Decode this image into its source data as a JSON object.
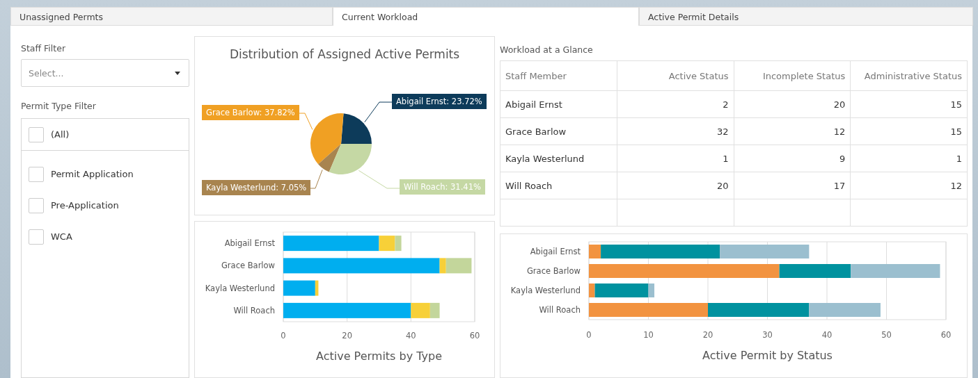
{
  "tabs": [
    {
      "label": "Unassigned Permts",
      "selected": false
    },
    {
      "label": "Current Workload",
      "selected": true
    },
    {
      "label": "Active Permit Details",
      "selected": false
    }
  ],
  "filters": {
    "staff_label": "Staff Filter",
    "staff_select": {
      "placeholder": "Select..."
    },
    "type_label": "Permit Type Filter",
    "type_options": [
      {
        "label": "(All)",
        "checked": false
      },
      {
        "label": "Permit Application",
        "checked": false
      },
      {
        "label": "Pre-Application",
        "checked": false
      },
      {
        "label": "WCA",
        "checked": false
      }
    ]
  },
  "distribution": {
    "chart_data": {
      "type": "pie",
      "title": "Distribution of Assigned Active Permits",
      "series": [
        {
          "colors": [
            "#0d3b5a",
            "#f0a023",
            "#a8844f",
            "#c5d8a4"
          ],
          "values": [
            23.72,
            37.82,
            7.05,
            31.41
          ]
        }
      ],
      "value_labels": [
        "Abigail Ernst: 23.72%",
        "Grace Barlow: 37.82%",
        "Kayla Westerlund: 7.05%",
        "Will Roach: 31.41%"
      ]
    }
  },
  "by_type": {
    "chart_data": {
      "type": "bar",
      "grid": true,
      "orientation": "horizontal",
      "stacked": true,
      "xlabel": "Active Permits by Type",
      "categories": [
        "Abigail Ernst",
        "Grace Barlow",
        "Kayla Westerlund",
        "Will Roach"
      ],
      "xlim": [
        0,
        60
      ],
      "xticks": [
        0,
        20,
        40,
        60
      ],
      "series": [
        {
          "color": "#00aeef",
          "values": [
            30,
            49,
            10,
            40
          ]
        },
        {
          "color": "#f7d038",
          "values": [
            5,
            2,
            1,
            6
          ]
        },
        {
          "color": "#c3d69b",
          "values": [
            2,
            8,
            0,
            3
          ]
        }
      ]
    }
  },
  "workload": {
    "title": "Workload at a Glance",
    "columns": [
      "Staff Member",
      "Active Status",
      "Incomplete Status",
      "Administrative Status"
    ],
    "rows": [
      [
        "Abigail Ernst",
        "2",
        "20",
        "15"
      ],
      [
        "Grace Barlow",
        "32",
        "12",
        "15"
      ],
      [
        "Kayla Westerlund",
        "1",
        "9",
        "1"
      ],
      [
        "Will Roach",
        "20",
        "17",
        "12"
      ]
    ]
  },
  "by_status": {
    "chart_data": {
      "type": "bar",
      "grid": true,
      "orientation": "horizontal",
      "stacked": true,
      "xlabel": "Active Permit by Status",
      "categories": [
        "Abigail Ernst",
        "Grace Barlow",
        "Kayla Westerlund",
        "Will Roach"
      ],
      "xlim": [
        0,
        60
      ],
      "xticks": [
        0,
        10,
        20,
        30,
        40,
        50,
        60
      ],
      "series": [
        {
          "color": "#f29340",
          "values": [
            2,
            32,
            1,
            20
          ]
        },
        {
          "color": "#00929f",
          "values": [
            20,
            12,
            9,
            17
          ]
        },
        {
          "color": "#9bbfcf",
          "values": [
            15,
            15,
            1,
            12
          ]
        }
      ]
    }
  }
}
